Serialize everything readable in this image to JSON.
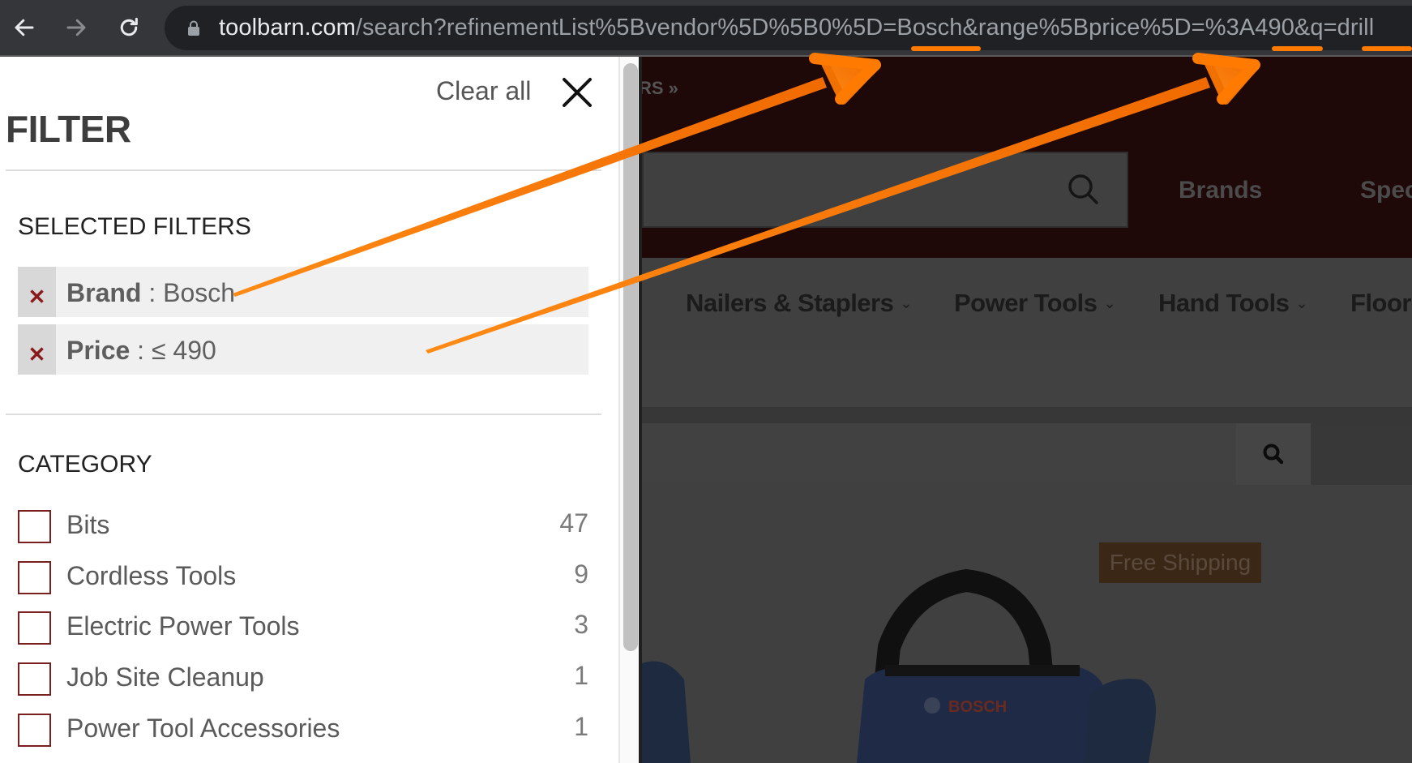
{
  "browser": {
    "back_icon": "arrow-left-icon",
    "forward_icon": "arrow-right-icon",
    "reload_icon": "reload-icon",
    "lock_icon": "lock-icon",
    "url_host": "toolbarn.com",
    "url_path": "/search?refinementList%5Bvendor%5D%5B0%5D=Bosch&range%5Bprice%5D=%3A490&q=drill"
  },
  "filter_panel": {
    "title": "FILTER",
    "clear_all_label": "Clear all",
    "close_icon": "close-icon",
    "selected_filters": {
      "heading": "SELECTED FILTERS",
      "items": [
        {
          "name": "Brand",
          "separator": " : ",
          "value": "Bosch"
        },
        {
          "name": "Price",
          "separator": " : ",
          "value": "≤ 490"
        }
      ]
    },
    "category": {
      "heading": "CATEGORY",
      "items": [
        {
          "label": "Bits",
          "count": "47",
          "checked": false
        },
        {
          "label": "Cordless Tools",
          "count": "9",
          "checked": false
        },
        {
          "label": "Electric Power Tools",
          "count": "3",
          "checked": false
        },
        {
          "label": "Job Site Cleanup",
          "count": "1",
          "checked": false
        },
        {
          "label": "Power Tool Accessories",
          "count": "1",
          "checked": false
        }
      ]
    }
  },
  "background_site": {
    "breadcrumb_fragment": "RS »",
    "header_links": [
      "Brands",
      "Spec"
    ],
    "category_nav": [
      {
        "label": "Nailers & Staplers",
        "has_dropdown": true
      },
      {
        "label": "Power Tools",
        "has_dropdown": true
      },
      {
        "label": "Hand Tools",
        "has_dropdown": true
      },
      {
        "label": "Floor",
        "has_dropdown": false
      }
    ],
    "product_badge": "Free Shipping",
    "product_brand_mark": "BOSCH",
    "chevron_glyph": "⌄"
  },
  "annotations": {
    "color": "#ff7a00",
    "arrows": [
      {
        "from": "selected-filter-brand",
        "to": "url-param-vendor-bosch"
      },
      {
        "from": "selected-filter-price",
        "to": "url-param-price-490"
      }
    ],
    "underlined_url_parts": [
      "Bosch",
      "490",
      "drill"
    ]
  }
}
